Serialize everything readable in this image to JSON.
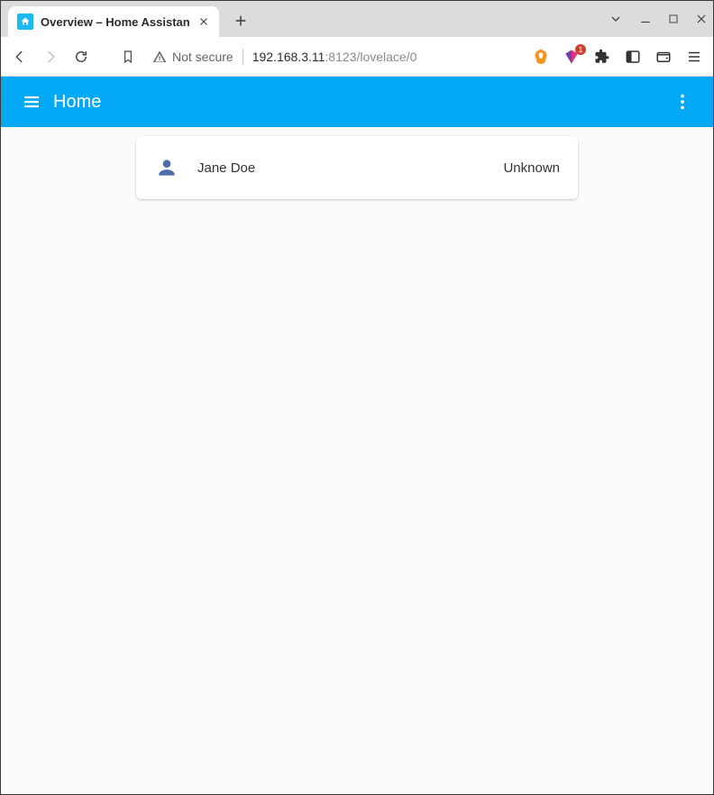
{
  "browser": {
    "tab_title": "Overview – Home Assistan",
    "security_label": "Not secure",
    "url_host": "192.168.3.11",
    "url_path": ":8123/lovelace/0",
    "shield_count": "1"
  },
  "app": {
    "header_title": "Home",
    "entities": [
      {
        "name": "Jane Doe",
        "state": "Unknown"
      }
    ]
  }
}
